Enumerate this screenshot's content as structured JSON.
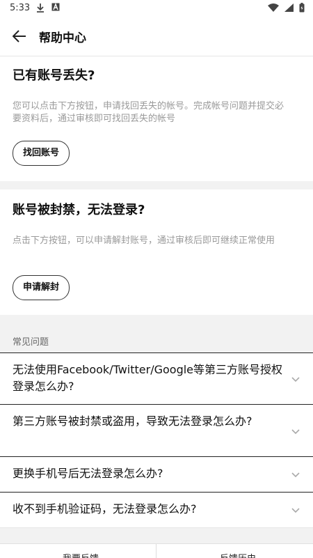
{
  "status_bar": {
    "time": "5:33",
    "left_icons": [
      "download-icon",
      "app-a-icon"
    ],
    "right_icons": [
      "wifi-icon",
      "signal-icon",
      "battery-icon"
    ]
  },
  "header": {
    "title": "帮助中心",
    "back_icon": "arrow-left-icon"
  },
  "recover_card": {
    "title": "已有账号丢失?",
    "description": "您可以点击下方按钮，申请找回丢失的帐号。完成帐号问题并提交必要资料后，通过审核即可找回丢失的帐号",
    "button_label": "找回账号"
  },
  "unban_card": {
    "title": "账号被封禁，无法登录?",
    "description": "点击下方按钮，可以申请解封账号，通过审核后即可继续正常使用",
    "button_label": "申请解封"
  },
  "faq": {
    "header": "常见问题",
    "items": [
      {
        "question": "无法使用Facebook/Twitter/Google等第三方账号授权登录怎么办?"
      },
      {
        "question": "第三方账号被封禁或盗用，导致无法登录怎么办?"
      },
      {
        "question": "更换手机号后无法登录怎么办?"
      },
      {
        "question": "收不到手机验证码，无法登录怎么办?"
      }
    ]
  },
  "bottom_tabs": [
    "我要反馈",
    "反馈历史"
  ],
  "colors": {
    "background": "#f2f2f2",
    "card": "#ffffff",
    "text": "#111111",
    "muted_text": "#9a9a9a"
  }
}
